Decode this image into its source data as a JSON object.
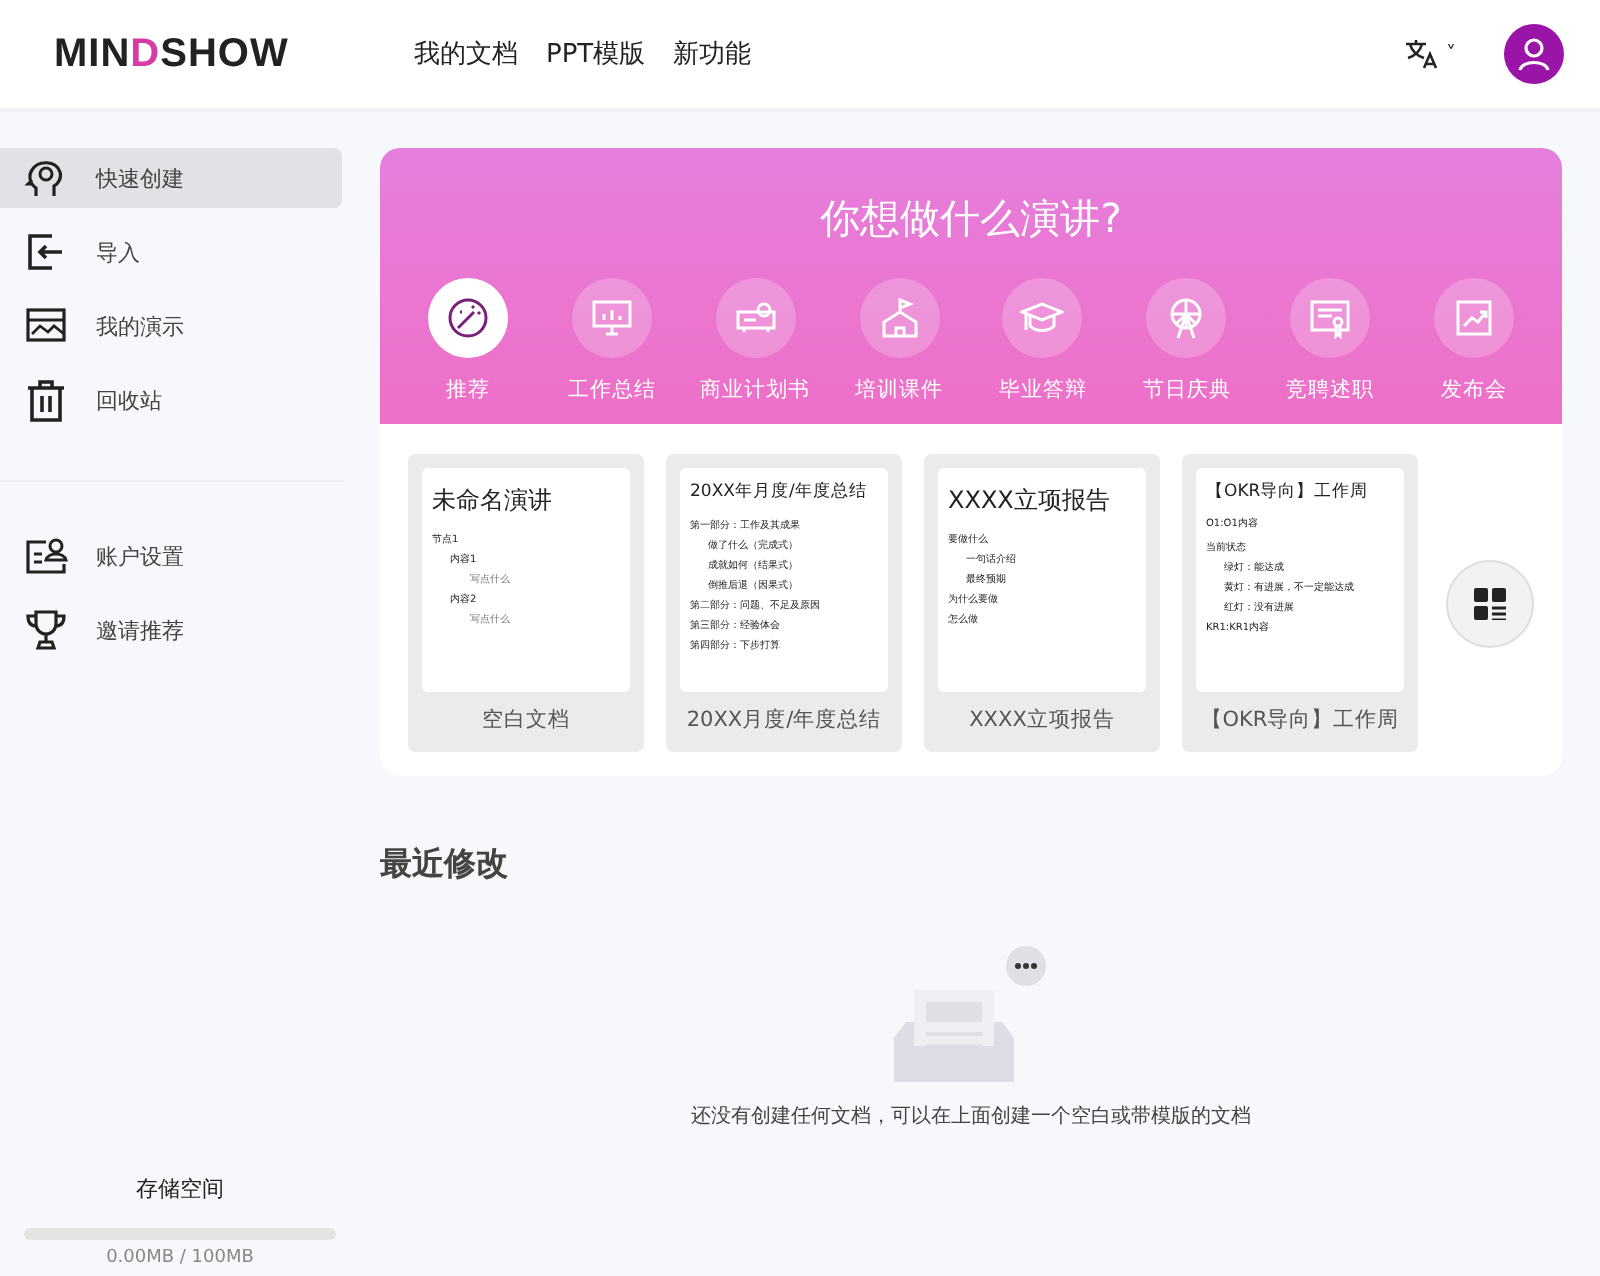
{
  "header": {
    "logo_parts": [
      "MIN",
      "D",
      "SHOW"
    ],
    "nav": [
      "我的文档",
      "PPT模版",
      "新功能"
    ],
    "language_caret": "˅"
  },
  "sidebar": {
    "items": [
      {
        "label": "快速创建",
        "selected": true
      },
      {
        "label": "导入",
        "selected": false
      },
      {
        "label": "我的演示",
        "selected": false
      },
      {
        "label": "回收站",
        "selected": false
      }
    ],
    "account_items": [
      {
        "label": "账户设置"
      },
      {
        "label": "邀请推荐"
      }
    ],
    "storage": {
      "label": "存储空间",
      "level": 0,
      "reading": "0.00MB / 100MB"
    }
  },
  "banner": {
    "title": "你想做什么演讲?",
    "categories": [
      {
        "label": "推荐",
        "selected": true
      },
      {
        "label": "工作总结",
        "selected": false
      },
      {
        "label": "商业计划书",
        "selected": false
      },
      {
        "label": "培训课件",
        "selected": false
      },
      {
        "label": "毕业答辩",
        "selected": false
      },
      {
        "label": "节日庆典",
        "selected": false
      },
      {
        "label": "竞聘述职",
        "selected": false
      },
      {
        "label": "发布会",
        "selected": false
      }
    ]
  },
  "templates": [
    {
      "title": "未命名演讲",
      "caption": "空白文档",
      "outline": [
        {
          "text": "节点1",
          "children": [
            {
              "text": "内容1",
              "children": [
                {
                  "text": "写点什么"
                }
              ]
            },
            {
              "text": "内容2",
              "children": [
                {
                  "text": "写点什么"
                }
              ]
            }
          ]
        }
      ]
    },
    {
      "title": "20XX年月度/年度总结",
      "caption": "20XX月度/年度总结",
      "outline": [
        {
          "text": "第一部分：工作及其成果",
          "children": [
            {
              "text": "做了什么（完成式）"
            },
            {
              "text": "成就如何（结果式）"
            },
            {
              "text": "倒推后退（因果式）"
            }
          ]
        },
        {
          "text": "第二部分：问题、不足及原因"
        },
        {
          "text": "第三部分：经验体会"
        },
        {
          "text": "第四部分：下步打算"
        }
      ]
    },
    {
      "title": "XXXX立项报告",
      "caption": "XXXX立项报告",
      "outline": [
        {
          "text": "要做什么",
          "children": [
            {
              "text": "一句话介绍"
            },
            {
              "text": "最终预期"
            }
          ]
        },
        {
          "text": "为什么要做"
        },
        {
          "text": "怎么做"
        }
      ]
    },
    {
      "title": "【OKR导向】工作周",
      "caption": "【OKR导向】工作周",
      "lead": "O1:O1内容",
      "outline": [
        {
          "text": "当前状态",
          "children": [
            {
              "text": "绿灯：能达成"
            },
            {
              "text": "黄灯：有进展，不一定能达成"
            },
            {
              "text": "红灯：没有进展"
            }
          ]
        },
        {
          "text": "KR1:KR1内容"
        }
      ]
    }
  ],
  "recent": {
    "title": "最近修改",
    "empty_message": "还没有创建任何文档，可以在上面创建一个空白或带模版的文档"
  }
}
